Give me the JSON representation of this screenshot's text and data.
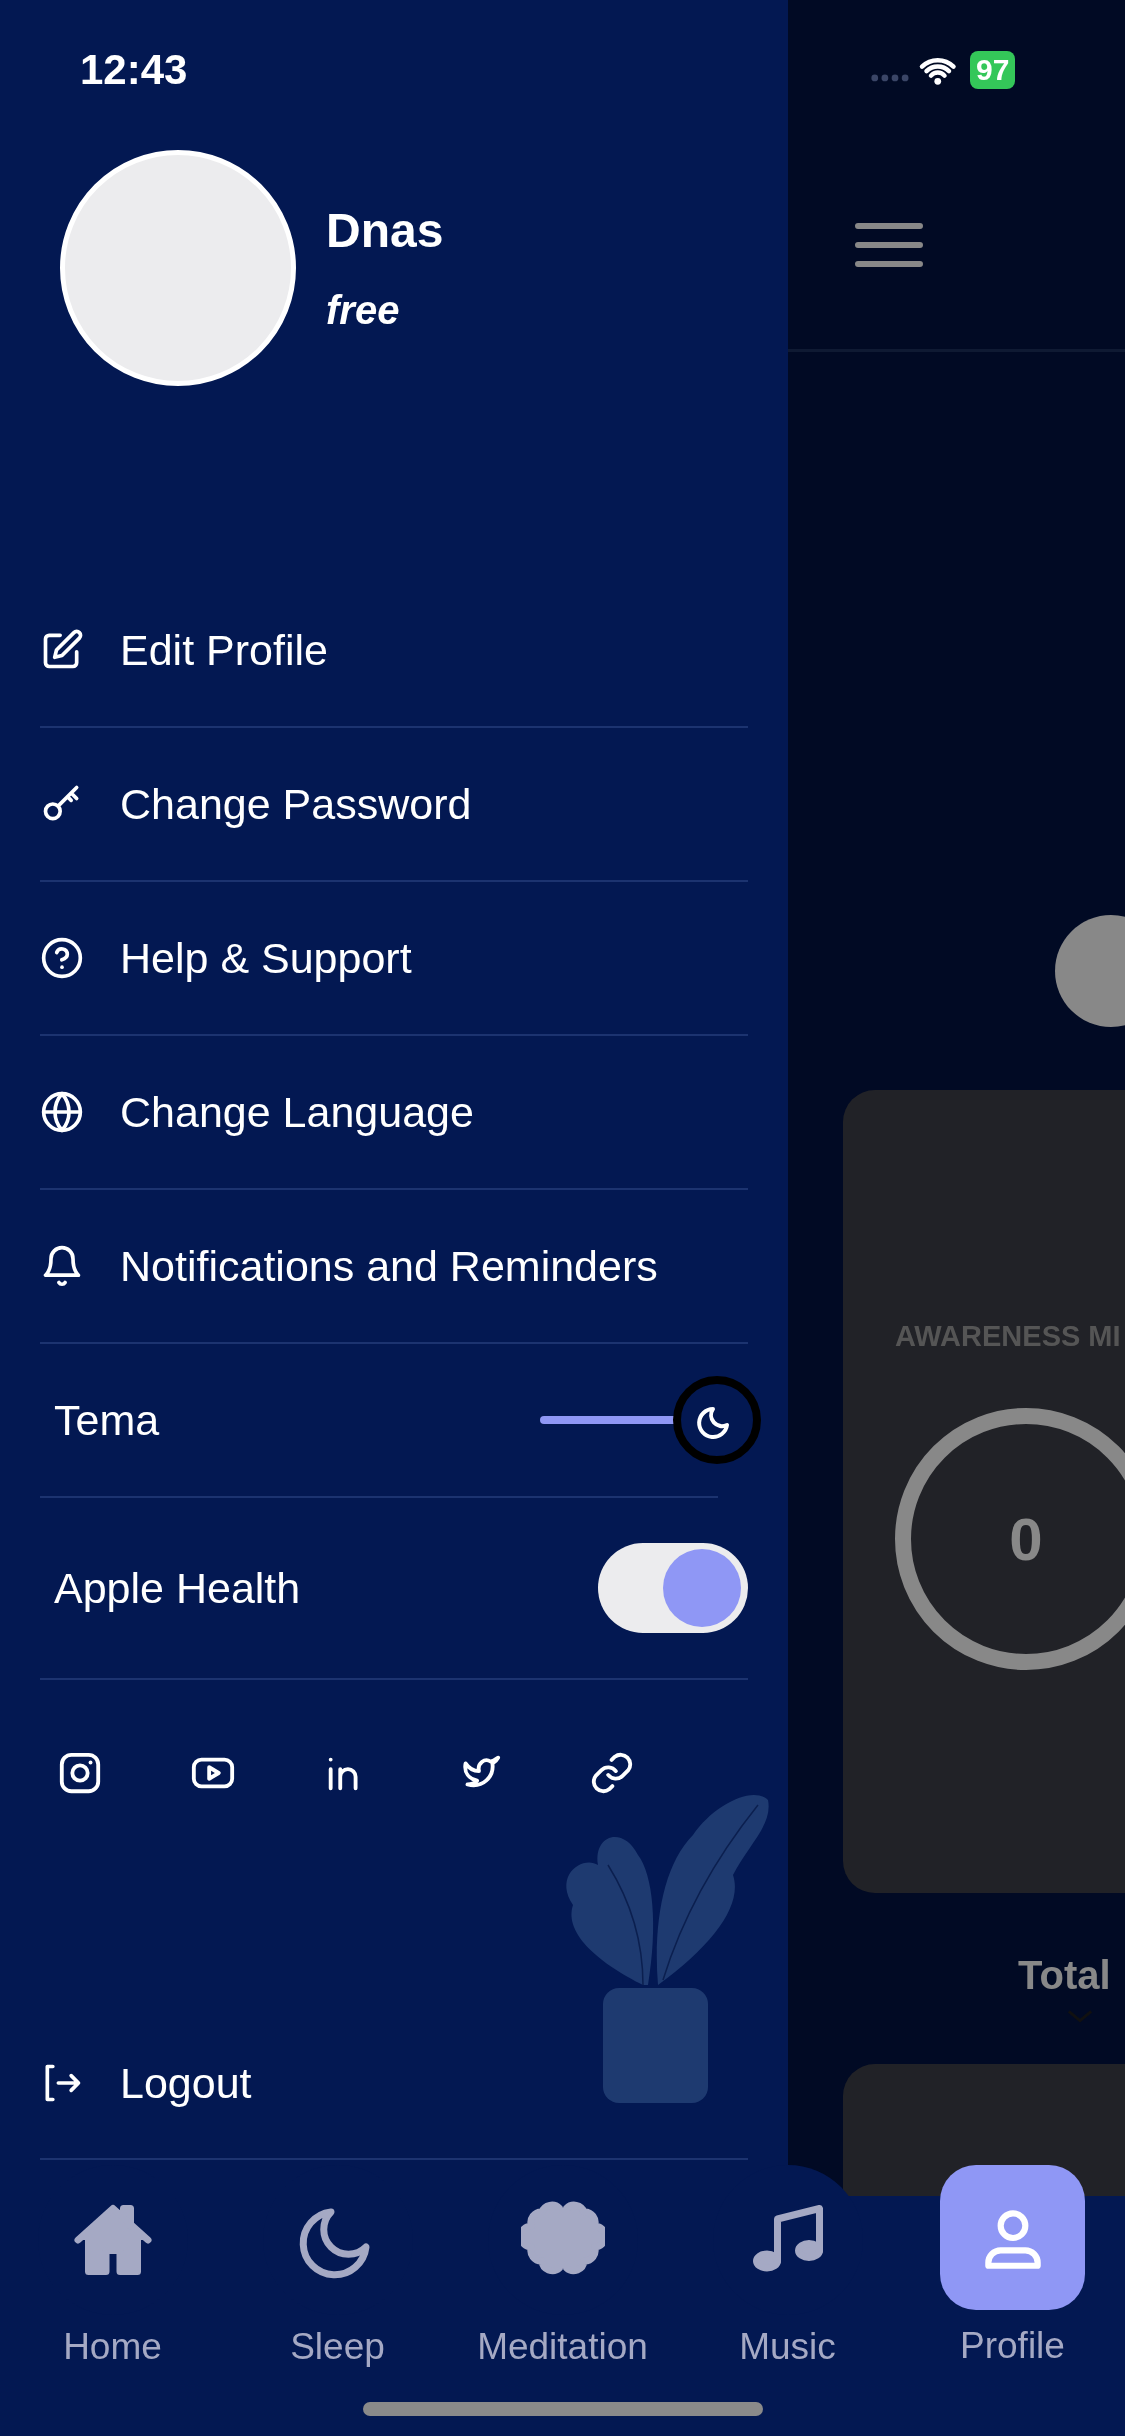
{
  "status_bar": {
    "time": "12:43",
    "battery": "97"
  },
  "profile": {
    "name": "Dnas",
    "plan": "free"
  },
  "menu": [
    {
      "kind": "edit",
      "label": "Edit Profile"
    },
    {
      "kind": "key",
      "label": "Change Password"
    },
    {
      "kind": "help",
      "label": "Help & Support"
    },
    {
      "kind": "globe",
      "label": "Change Language"
    },
    {
      "kind": "bell",
      "label": "Notifications and Reminders"
    }
  ],
  "settings": [
    {
      "kind": "slider",
      "label": "Tema",
      "on": true
    },
    {
      "kind": "switch",
      "label": "Apple Health",
      "on": true
    }
  ],
  "social": [
    {
      "kind": "instagram"
    },
    {
      "kind": "video"
    },
    {
      "kind": "linkedin"
    },
    {
      "kind": "bird"
    },
    {
      "kind": "link"
    }
  ],
  "logout": {
    "label": "Logout"
  },
  "background_page": {
    "card_title": "AWARENESS MI",
    "score": "0",
    "section": "Total"
  },
  "tabs": [
    {
      "kind": "home",
      "label": "Home",
      "selected": false
    },
    {
      "kind": "moon",
      "label": "Sleep",
      "selected": false
    },
    {
      "kind": "brain",
      "label": "Meditation",
      "selected": false
    },
    {
      "kind": "music",
      "label": "Music",
      "selected": false
    },
    {
      "kind": "user",
      "label": "Profile",
      "selected": true
    }
  ]
}
